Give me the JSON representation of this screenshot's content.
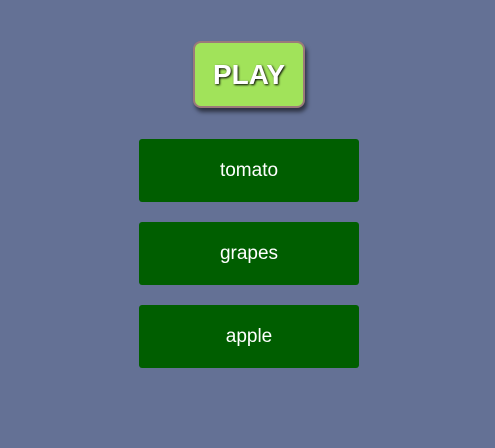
{
  "play": {
    "label": "PLAY"
  },
  "options": [
    {
      "label": "tomato"
    },
    {
      "label": "grapes"
    },
    {
      "label": "apple"
    }
  ],
  "colors": {
    "background": "#647195",
    "play_fill": "#a1e35a",
    "play_border": "#9b7a7a",
    "option_fill": "#005e00",
    "text": "#ffffff"
  }
}
